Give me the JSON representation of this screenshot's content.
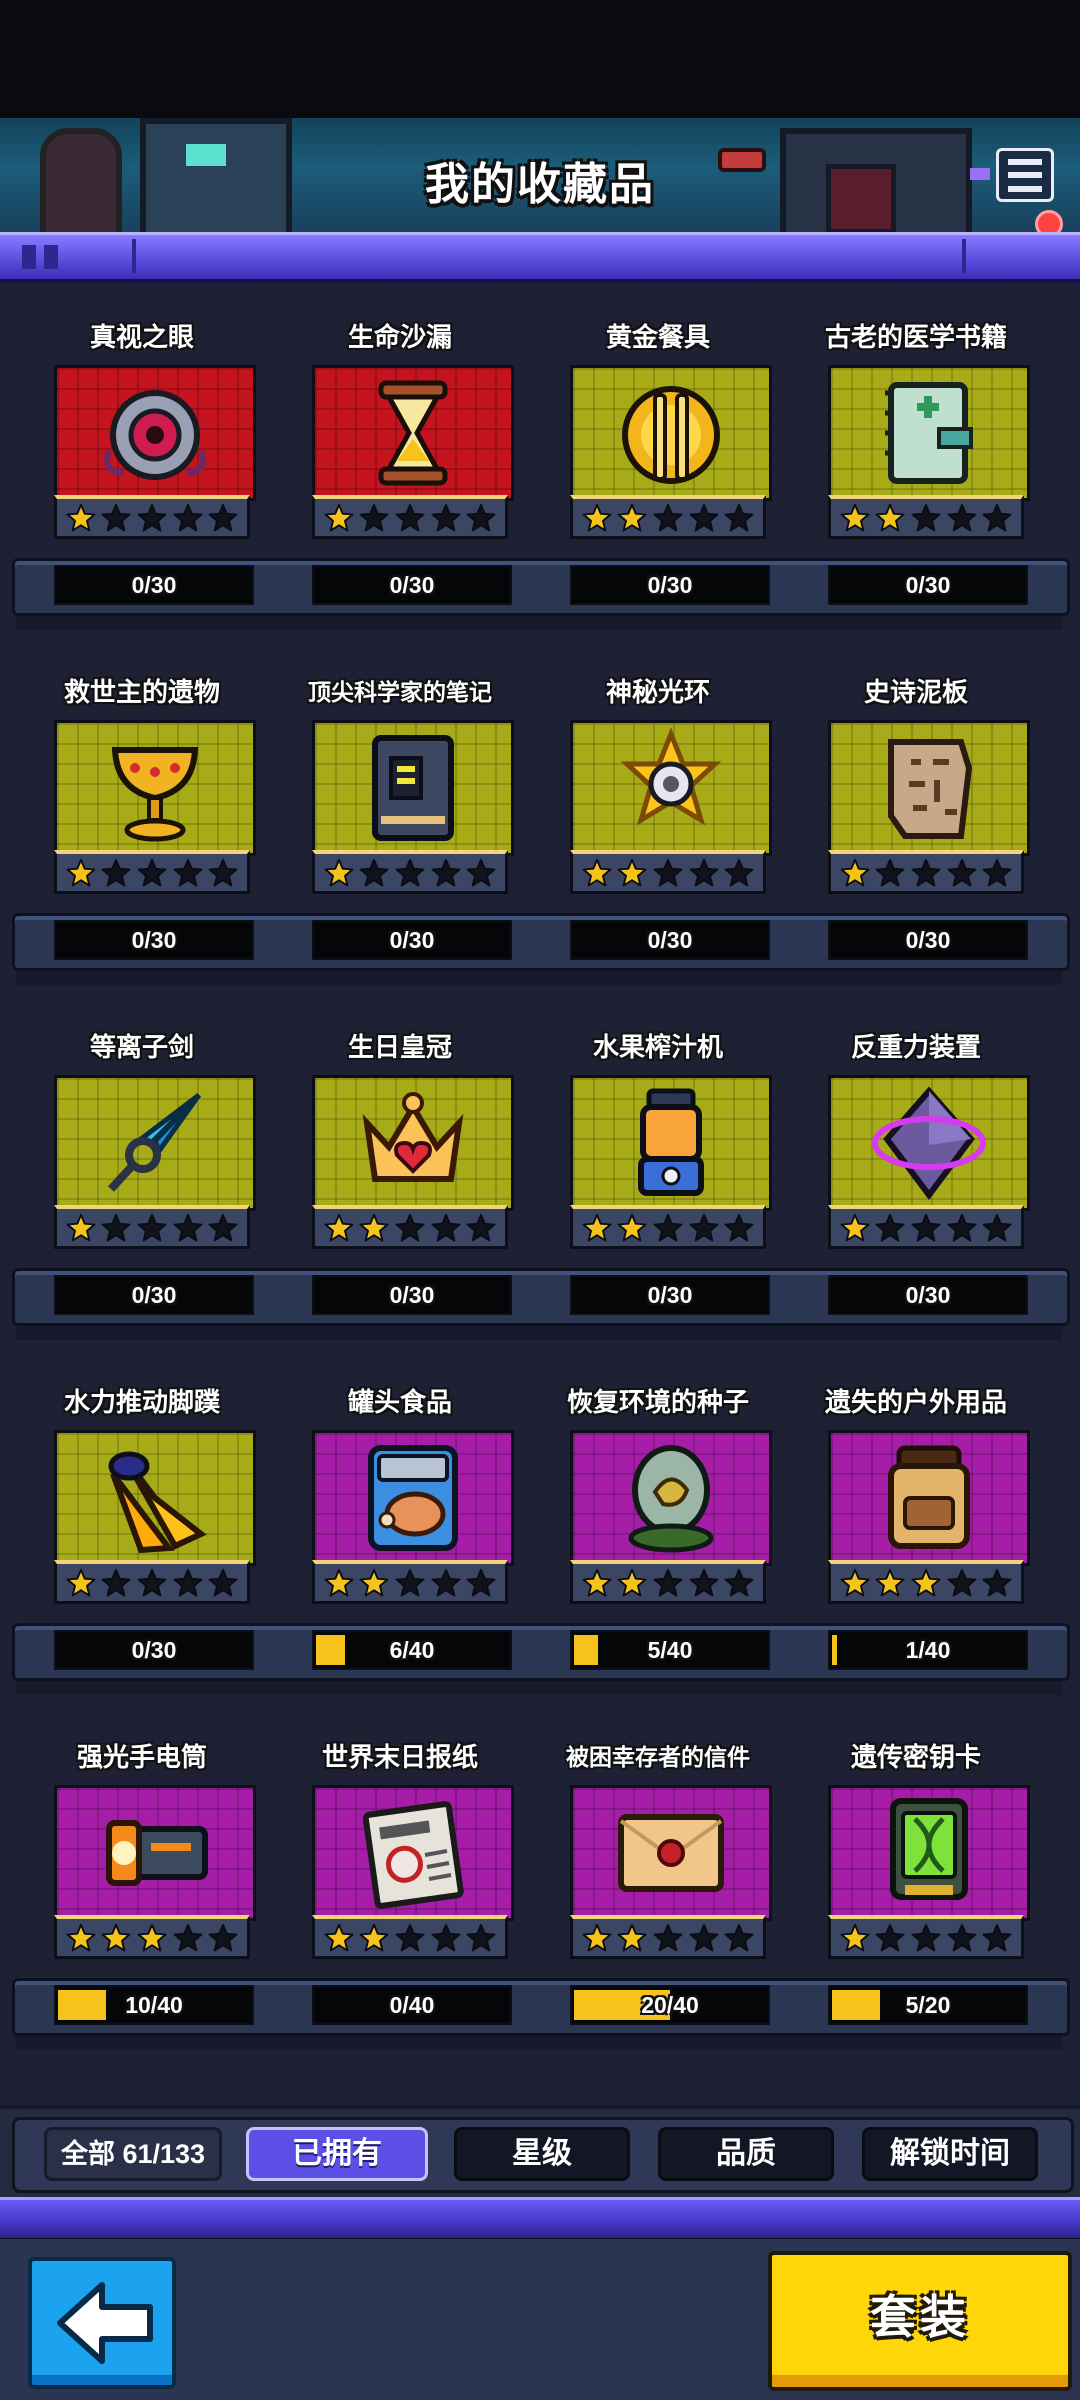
{
  "header": {
    "title": "我的收藏品"
  },
  "colors": {
    "star_filled": "#f6c21c",
    "star_empty": "#10131c",
    "accent_purple": "#5b4fe5",
    "progress_fill": "#f6c21c"
  },
  "collection": {
    "rows": [
      {
        "items": [
          {
            "name": "真视之眼",
            "bg": "red",
            "icon": "eye-orb-icon",
            "stars": 1,
            "progress": "0/30",
            "fill": 0
          },
          {
            "name": "生命沙漏",
            "bg": "red",
            "icon": "hourglass-icon",
            "stars": 1,
            "progress": "0/30",
            "fill": 0
          },
          {
            "name": "黄金餐具",
            "bg": "yellow",
            "icon": "golden-cutlery-icon",
            "stars": 2,
            "progress": "0/30",
            "fill": 0
          },
          {
            "name": "古老的医学书籍",
            "bg": "yellow",
            "icon": "medical-book-icon",
            "stars": 2,
            "progress": "0/30",
            "fill": 0
          }
        ]
      },
      {
        "items": [
          {
            "name": "救世主的遗物",
            "bg": "yellow",
            "icon": "golden-chalice-icon",
            "stars": 1,
            "progress": "0/30",
            "fill": 0
          },
          {
            "name": "顶尖科学家的笔记",
            "bg": "yellow",
            "icon": "scientist-notebook-icon",
            "stars": 1,
            "progress": "0/30",
            "fill": 0,
            "small": true
          },
          {
            "name": "神秘光环",
            "bg": "yellow",
            "icon": "mystic-halo-icon",
            "stars": 2,
            "progress": "0/30",
            "fill": 0
          },
          {
            "name": "史诗泥板",
            "bg": "yellow",
            "icon": "clay-tablet-icon",
            "stars": 1,
            "progress": "0/30",
            "fill": 0
          }
        ]
      },
      {
        "items": [
          {
            "name": "等离子剑",
            "bg": "yellow",
            "icon": "plasma-sword-icon",
            "stars": 1,
            "progress": "0/30",
            "fill": 0
          },
          {
            "name": "生日皇冠",
            "bg": "yellow",
            "icon": "birthday-crown-icon",
            "stars": 2,
            "progress": "0/30",
            "fill": 0
          },
          {
            "name": "水果榨汁机",
            "bg": "yellow",
            "icon": "juicer-icon",
            "stars": 2,
            "progress": "0/30",
            "fill": 0
          },
          {
            "name": "反重力装置",
            "bg": "yellow",
            "icon": "anti-gravity-crystal-icon",
            "stars": 1,
            "progress": "0/30",
            "fill": 0
          }
        ]
      },
      {
        "items": [
          {
            "name": "水力推动脚蹼",
            "bg": "yellow",
            "icon": "flippers-icon",
            "stars": 1,
            "progress": "0/30",
            "fill": 0
          },
          {
            "name": "罐头食品",
            "bg": "purple",
            "icon": "canned-food-icon",
            "stars": 2,
            "progress": "6/40",
            "fill": 0.15
          },
          {
            "name": "恢复环境的种子",
            "bg": "purple",
            "icon": "seed-capsule-icon",
            "stars": 2,
            "progress": "5/40",
            "fill": 0.125
          },
          {
            "name": "遗失的户外用品",
            "bg": "purple",
            "icon": "backpack-icon",
            "stars": 3,
            "progress": "1/40",
            "fill": 0.025
          }
        ]
      },
      {
        "items": [
          {
            "name": "强光手电筒",
            "bg": "purple",
            "icon": "flashlight-icon",
            "stars": 3,
            "progress": "10/40",
            "fill": 0.25
          },
          {
            "name": "世界末日报纸",
            "bg": "purple",
            "icon": "newspaper-icon",
            "stars": 2,
            "progress": "0/40",
            "fill": 0
          },
          {
            "name": "被困幸存者的信件",
            "bg": "purple",
            "icon": "sealed-letter-icon",
            "stars": 2,
            "progress": "20/40",
            "fill": 0.5,
            "small": true
          },
          {
            "name": "遗传密钥卡",
            "bg": "purple",
            "icon": "dna-keycard-icon",
            "stars": 1,
            "progress": "5/20",
            "fill": 0.25
          }
        ]
      }
    ]
  },
  "filters": {
    "all": "全部 61/133",
    "owned": "已拥有",
    "rarity": "星级",
    "quality": "品质",
    "unlock_time": "解锁时间"
  },
  "bottom": {
    "outfit": "套装"
  }
}
